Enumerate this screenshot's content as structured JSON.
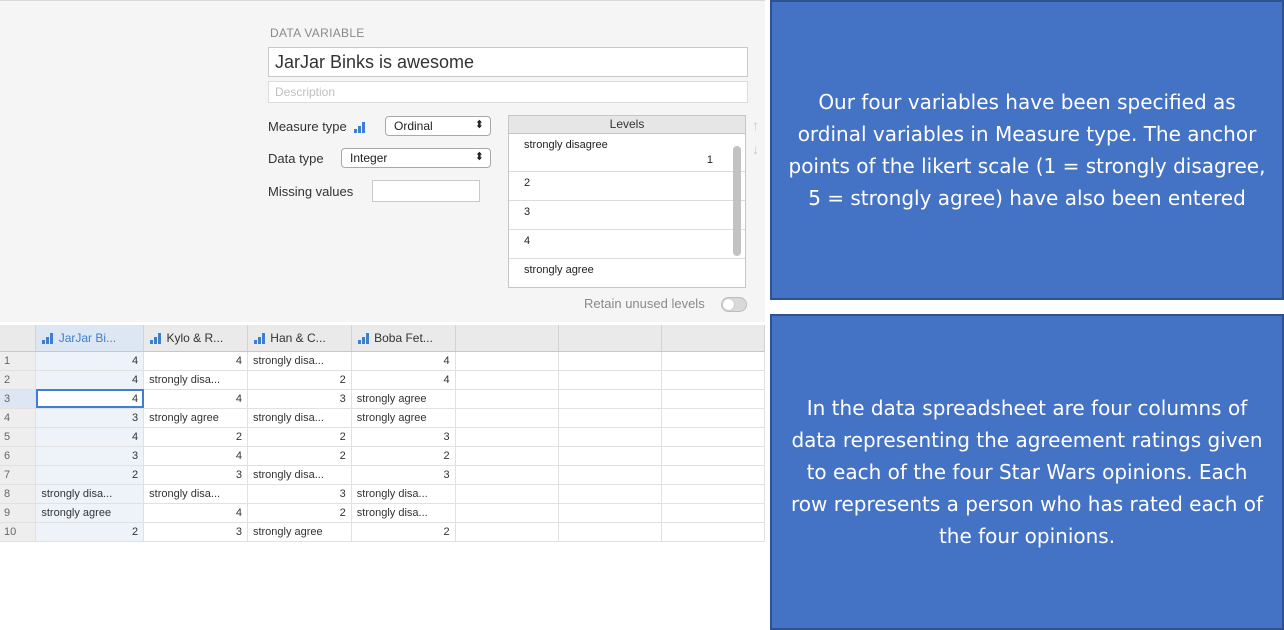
{
  "setup": {
    "heading": "DATA VARIABLE",
    "name_value": "JarJar Binks is awesome",
    "description_placeholder": "Description",
    "measure_label": "Measure type",
    "measure_value": "Ordinal",
    "datatype_label": "Data type",
    "datatype_value": "Integer",
    "missing_label": "Missing values",
    "levels_header": "Levels",
    "levels": [
      {
        "label": "strongly disagree",
        "value": "1"
      },
      {
        "label": "2",
        "value": ""
      },
      {
        "label": "3",
        "value": ""
      },
      {
        "label": "4",
        "value": ""
      },
      {
        "label": "strongly agree",
        "value": ""
      }
    ],
    "retain_label": "Retain unused levels",
    "arrow_up": "↑",
    "arrow_down": "↓"
  },
  "sheet": {
    "columns": [
      "JarJar Bi...",
      "Kylo & R...",
      "Han & C...",
      "Boba Fet..."
    ],
    "rows": [
      [
        "4",
        "4",
        "strongly disa...",
        "4"
      ],
      [
        "4",
        "strongly disa...",
        "2",
        "4"
      ],
      [
        "4",
        "4",
        "3",
        "strongly agree"
      ],
      [
        "3",
        "strongly agree",
        "strongly disa...",
        "strongly agree"
      ],
      [
        "4",
        "2",
        "2",
        "3"
      ],
      [
        "3",
        "4",
        "2",
        "2"
      ],
      [
        "2",
        "3",
        "strongly disa...",
        "3"
      ],
      [
        "strongly disa...",
        "strongly disa...",
        "3",
        "strongly disa..."
      ],
      [
        "strongly agree",
        "4",
        "2",
        "strongly disa..."
      ],
      [
        "2",
        "3",
        "strongly agree",
        "2"
      ]
    ]
  },
  "notes": {
    "top": "Our four variables have been specified as ordinal variables in Measure type.  The anchor points of the likert scale (1 = strongly disagree, 5 = strongly agree) have also been entered",
    "bottom": "In the data spreadsheet are four columns of data representing the agreement ratings given to each of the four Star Wars opinions.  Each row represents a person who has rated each of the four opinions."
  },
  "colors": {
    "accent": "#3d7fd0",
    "note_bg": "#4472c4",
    "note_border": "#2f528f"
  },
  "icons": {
    "measure": "ordinal-bars-icon",
    "select_caret": "updown-caret-icon"
  }
}
